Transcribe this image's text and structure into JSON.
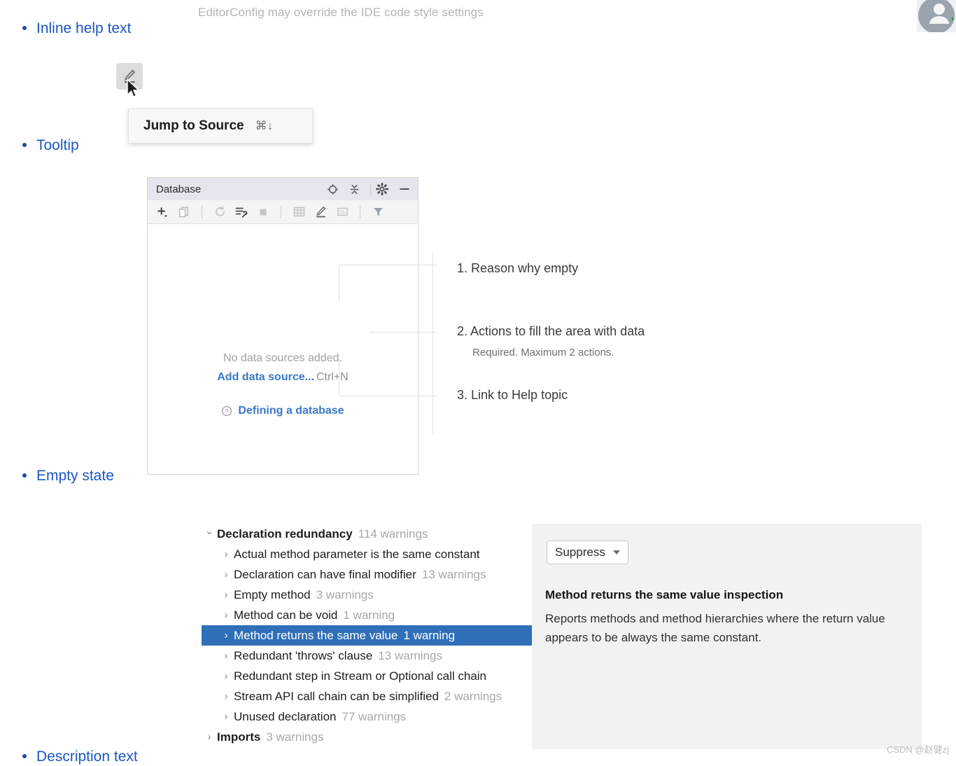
{
  "sections": [
    {
      "label": "Inline help text"
    },
    {
      "label": "Tooltip"
    },
    {
      "label": "Empty state"
    },
    {
      "label": "Description text"
    }
  ],
  "inline_help": {
    "caption": "EditorConfig may override the IDE code style settings"
  },
  "tooltip_demo": {
    "button_icon": "pencil-edit-icon",
    "cursor_icon": "mouse-pointer-icon",
    "tooltip_label": "Jump to Source",
    "tooltip_shortcut": "⌘↓"
  },
  "database_panel": {
    "title": "Database",
    "title_icons": [
      "locate-target-icon",
      "collapse-all-icon",
      "settings-gear-icon",
      "minimize-icon"
    ],
    "toolbar_icons": [
      "add-plus-icon",
      "copy-duplicate-icon",
      "refresh-sync-icon",
      "run-configure-icon",
      "stop-square-icon",
      "table-grid-icon",
      "edit-pencil-icon",
      "query-console-icon",
      "filter-funnel-icon"
    ],
    "empty_state": {
      "reason": "No data sources added.",
      "action_link": "Add data source...",
      "action_shortcut": "Ctrl+N",
      "help_icon": "question-circle-icon",
      "help_link": "Defining a database"
    }
  },
  "callouts": [
    {
      "text": "1. Reason why empty",
      "sub": ""
    },
    {
      "text": "2. Actions to fill the area with data",
      "sub": "Required. Maximum 2 actions."
    },
    {
      "text": "3. Link to Help topic",
      "sub": ""
    }
  ],
  "inspection_tree": {
    "rows": [
      {
        "label": "Declaration redundancy",
        "count": "114 warnings",
        "indent": 0,
        "bold": true,
        "expanded": true,
        "selected": false
      },
      {
        "label": "Actual method parameter is the same constant",
        "count": "",
        "indent": 1,
        "bold": false,
        "expanded": false,
        "selected": false
      },
      {
        "label": "Declaration can have final modifier",
        "count": "13 warnings",
        "indent": 1,
        "bold": false,
        "expanded": false,
        "selected": false
      },
      {
        "label": "Empty method",
        "count": "3 warnings",
        "indent": 1,
        "bold": false,
        "expanded": false,
        "selected": false
      },
      {
        "label": "Method can be void",
        "count": "1 warning",
        "indent": 1,
        "bold": false,
        "expanded": false,
        "selected": false
      },
      {
        "label": "Method returns the same value",
        "count": "1 warning",
        "indent": 1,
        "bold": false,
        "expanded": false,
        "selected": true
      },
      {
        "label": "Redundant 'throws' clause",
        "count": "13 warnings",
        "indent": 1,
        "bold": false,
        "expanded": false,
        "selected": false
      },
      {
        "label": "Redundant step in Stream or Optional call chain",
        "count": "",
        "indent": 1,
        "bold": false,
        "expanded": false,
        "selected": false
      },
      {
        "label": "Stream API call chain can be simplified",
        "count": "2 warnings",
        "indent": 1,
        "bold": false,
        "expanded": false,
        "selected": false
      },
      {
        "label": "Unused declaration",
        "count": "77 warnings",
        "indent": 1,
        "bold": false,
        "expanded": false,
        "selected": false
      },
      {
        "label": "Imports",
        "count": "3 warnings",
        "indent": 0,
        "bold": true,
        "expanded": false,
        "selected": false
      }
    ]
  },
  "description_panel": {
    "suppress_label": "Suppress",
    "title": "Method returns the same value inspection",
    "body": "Reports methods and method hierarchies where the return value appears to be always the same constant."
  },
  "avatar": {
    "icon": "user-avatar-icon"
  },
  "watermark": {
    "text": "CSDN @赵健zj"
  },
  "colors": {
    "link_blue": "#1a56c4",
    "ide_link_blue": "#3a78c8",
    "selection_blue": "#2f6fb8",
    "muted_gray": "#a0a0a0"
  }
}
